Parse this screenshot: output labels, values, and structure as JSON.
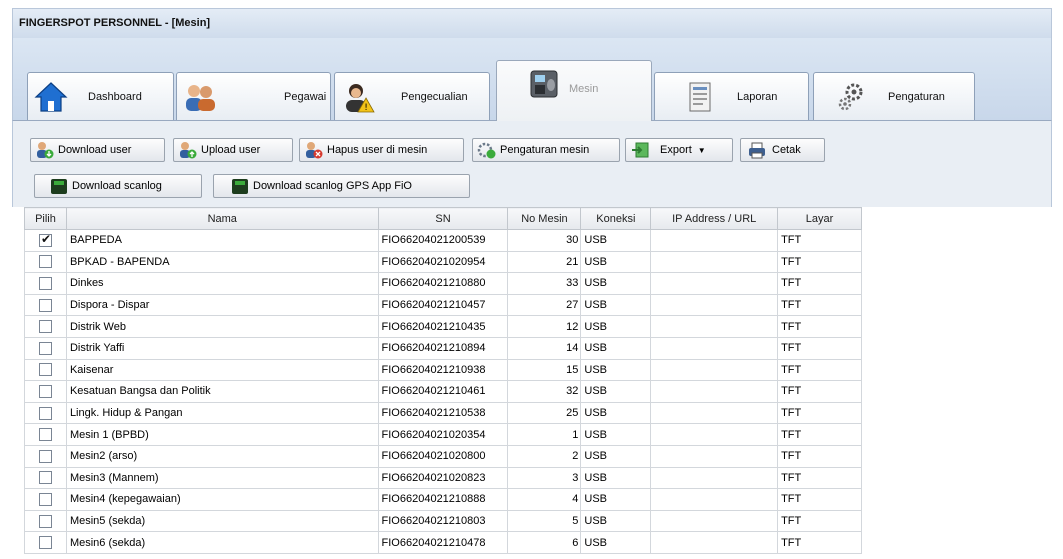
{
  "window": {
    "title": "FINGERSPOT PERSONNEL - [Mesin]"
  },
  "tabs": [
    {
      "label": "Dashboard",
      "icon": "home-icon"
    },
    {
      "label": "Pegawai",
      "icon": "employees-icon"
    },
    {
      "label": "Pengecualian",
      "icon": "exception-user-icon"
    },
    {
      "label": "Mesin",
      "icon": "fingerprint-machine-icon",
      "active": true
    },
    {
      "label": "Laporan",
      "icon": "report-icon"
    },
    {
      "label": "Pengaturan",
      "icon": "gears-icon"
    }
  ],
  "toolbar": {
    "download_user": "Download user",
    "upload_user": "Upload user",
    "hapus_user": "Hapus user di mesin",
    "pengaturan_mesin": "Pengaturan mesin",
    "export": "Export",
    "cetak": "Cetak",
    "download_scanlog": "Download scanlog",
    "download_scanlog_gps": "Download scanlog GPS App FiO"
  },
  "table": {
    "columns": [
      "Pilih",
      "Nama",
      "SN",
      "No Mesin",
      "Koneksi",
      "IP Address / URL",
      "Layar"
    ],
    "rows": [
      {
        "checked": true,
        "nama": "BAPPEDA",
        "sn": "FIO66204021200539",
        "no": "30",
        "koneksi": "USB",
        "ip": "",
        "layar": "TFT"
      },
      {
        "checked": false,
        "nama": "BPKAD - BAPENDA",
        "sn": "FIO66204021020954",
        "no": "21",
        "koneksi": "USB",
        "ip": "",
        "layar": "TFT"
      },
      {
        "checked": false,
        "nama": "Dinkes",
        "sn": "FIO66204021210880",
        "no": "33",
        "koneksi": "USB",
        "ip": "",
        "layar": "TFT"
      },
      {
        "checked": false,
        "nama": "Dispora - Dispar",
        "sn": "FIO66204021210457",
        "no": "27",
        "koneksi": "USB",
        "ip": "",
        "layar": "TFT"
      },
      {
        "checked": false,
        "nama": "Distrik Web",
        "sn": "FIO66204021210435",
        "no": "12",
        "koneksi": "USB",
        "ip": "",
        "layar": "TFT"
      },
      {
        "checked": false,
        "nama": "Distrik Yaffi",
        "sn": "FIO66204021210894",
        "no": "14",
        "koneksi": "USB",
        "ip": "",
        "layar": "TFT"
      },
      {
        "checked": false,
        "nama": "Kaisenar",
        "sn": "FIO66204021210938",
        "no": "15",
        "koneksi": "USB",
        "ip": "",
        "layar": "TFT"
      },
      {
        "checked": false,
        "nama": "Kesatuan Bangsa dan Politik",
        "sn": "FIO66204021210461",
        "no": "32",
        "koneksi": "USB",
        "ip": "",
        "layar": "TFT"
      },
      {
        "checked": false,
        "nama": "Lingk. Hidup & Pangan",
        "sn": "FIO66204021210538",
        "no": "25",
        "koneksi": "USB",
        "ip": "",
        "layar": "TFT"
      },
      {
        "checked": false,
        "nama": "Mesin 1 (BPBD)",
        "sn": "FIO66204021020354",
        "no": "1",
        "koneksi": "USB",
        "ip": "",
        "layar": "TFT"
      },
      {
        "checked": false,
        "nama": "Mesin2 (arso)",
        "sn": "FIO66204021020800",
        "no": "2",
        "koneksi": "USB",
        "ip": "",
        "layar": "TFT"
      },
      {
        "checked": false,
        "nama": "Mesin3 (Mannem)",
        "sn": "FIO66204021020823",
        "no": "3",
        "koneksi": "USB",
        "ip": "",
        "layar": "TFT"
      },
      {
        "checked": false,
        "nama": "Mesin4 (kepegawaian)",
        "sn": "FIO66204021210888",
        "no": "4",
        "koneksi": "USB",
        "ip": "",
        "layar": "TFT"
      },
      {
        "checked": false,
        "nama": "Mesin5 (sekda)",
        "sn": "FIO66204021210803",
        "no": "5",
        "koneksi": "USB",
        "ip": "",
        "layar": "TFT"
      },
      {
        "checked": false,
        "nama": "Mesin6 (sekda)",
        "sn": "FIO66204021210478",
        "no": "6",
        "koneksi": "USB",
        "ip": "",
        "layar": "TFT"
      }
    ]
  }
}
